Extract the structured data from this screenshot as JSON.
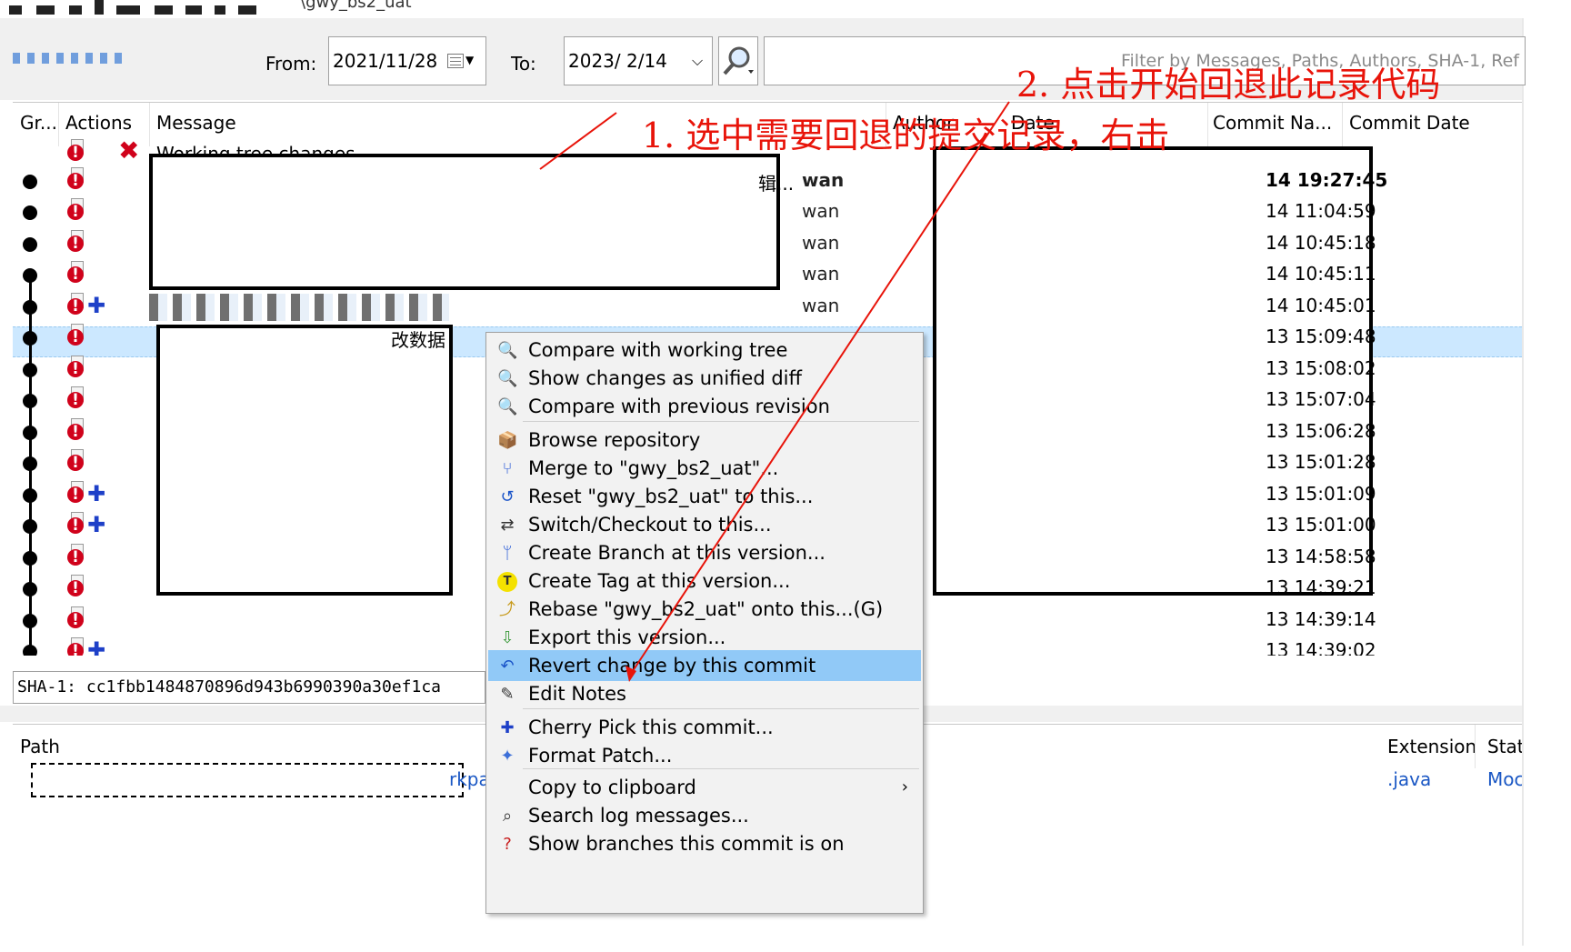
{
  "window": {
    "title": "\\gwy_bs2_uat"
  },
  "filter": {
    "from_label": "From:",
    "from_value": "2021/11/28",
    "to_label": "To:",
    "to_value": "2023/  2/14",
    "search_placeholder": "Filter by Messages, Paths, Authors, SHA-1, Ref"
  },
  "log": {
    "columns": [
      "Gr...",
      "Actions",
      "Message",
      "Author",
      "Date",
      "Commit Na...",
      "Commit Date"
    ],
    "rows": [
      {
        "message": "Working tree changes",
        "author": "",
        "commit_date": ""
      },
      {
        "message": "辑...",
        "author": "wan",
        "commit_date": "14 19:27:45"
      },
      {
        "message": "",
        "author": "wan",
        "commit_date": "14 11:04:59"
      },
      {
        "message": "",
        "author": "wan",
        "commit_date": "14 10:45:18"
      },
      {
        "message": "",
        "author": "wan",
        "commit_date": "14 10:45:11"
      },
      {
        "message": "",
        "author": "wan",
        "commit_date": "14 10:45:01"
      },
      {
        "message": "改数据",
        "author": "",
        "commit_date": "13 15:09:48"
      },
      {
        "message": "",
        "author": "",
        "commit_date": "13 15:08:02"
      },
      {
        "message": "",
        "author": "",
        "commit_date": "13 15:07:04"
      },
      {
        "message": "",
        "author": "",
        "commit_date": "13 15:06:28"
      },
      {
        "message": "",
        "author": "",
        "commit_date": "13 15:01:28"
      },
      {
        "message": "",
        "author": "",
        "commit_date": "13 15:01:09"
      },
      {
        "message": "",
        "author": "",
        "commit_date": "13 15:01:00"
      },
      {
        "message": "",
        "author": "",
        "commit_date": "13 14:58:58"
      },
      {
        "message": "",
        "author": "",
        "commit_date": "13 14:39:21"
      },
      {
        "message": "",
        "author": "",
        "commit_date": "13 14:39:14"
      },
      {
        "message": "",
        "author": "",
        "commit_date": "13 14:39:02"
      }
    ]
  },
  "sha": {
    "label": "SHA-1:",
    "value": "cc1fbb1484870896d943b6990390a30ef1ca"
  },
  "files": {
    "columns": [
      "Path",
      "Extension",
      "Statu"
    ],
    "rows": [
      {
        "path": "rkpa",
        "extension": ".java",
        "status": "Moc"
      }
    ]
  },
  "context_menu": {
    "items": [
      {
        "label": "Compare with working tree",
        "icon": "magnifier-icon"
      },
      {
        "label": "Show changes as unified diff",
        "icon": "magnifier-icon"
      },
      {
        "label": "Compare with previous revision",
        "icon": "magnifier-icon"
      },
      {
        "label": "Browse repository",
        "icon": "repository-icon"
      },
      {
        "label": "Merge to \"gwy_bs2_uat\"...",
        "icon": "merge-icon"
      },
      {
        "label": "Reset \"gwy_bs2_uat\" to this...",
        "icon": "reset-icon"
      },
      {
        "label": "Switch/Checkout to this...",
        "icon": "checkout-icon"
      },
      {
        "label": "Create Branch at this version...",
        "icon": "branch-icon"
      },
      {
        "label": "Create Tag at this version...",
        "icon": "tag-icon"
      },
      {
        "label": "Rebase \"gwy_bs2_uat\" onto this...(G)",
        "icon": "rebase-icon"
      },
      {
        "label": "Export this version...",
        "icon": "export-icon"
      },
      {
        "label": "Revert change by this commit",
        "icon": "revert-icon",
        "highlighted": true
      },
      {
        "label": "Edit Notes",
        "icon": "notes-icon"
      },
      {
        "label": "Cherry Pick this commit...",
        "icon": "cherry-pick-icon"
      },
      {
        "label": "Format Patch...",
        "icon": "patch-icon"
      },
      {
        "label": "Copy to clipboard",
        "icon": "",
        "submenu": true
      },
      {
        "label": "Search log messages...",
        "icon": "search-icon"
      },
      {
        "label": "Show branches this commit is on",
        "icon": "branches-icon"
      }
    ]
  },
  "annotations": {
    "step1": "1. 选中需要回退的提交记录，右击",
    "step2": "2. 点击开始回退此记录代码"
  },
  "colors": {
    "annotation": "#e8140a",
    "selection": "#cce8ff",
    "menu_highlight": "#91c9f7"
  }
}
